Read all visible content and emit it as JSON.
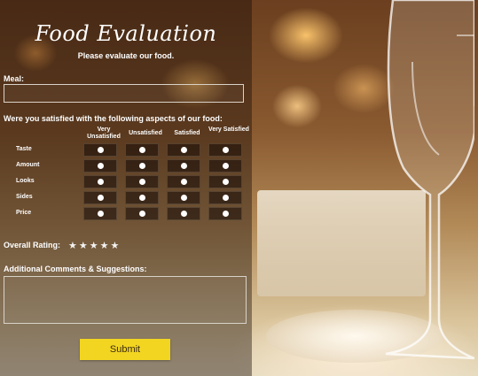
{
  "form": {
    "title": "Food Evaluation",
    "subtitle": "Please evaluate our food.",
    "meal_label": "Meal:",
    "meal_value": "",
    "satisfaction_label": "Were you satisfied with the following aspects of our food:",
    "columns": [
      "Very Unsatisfied",
      "Unsatisfied",
      "Satisfied",
      "Very Satisfied"
    ],
    "rows": [
      "Taste",
      "Amount",
      "Looks",
      "Sides",
      "Price"
    ],
    "overall_rating_label": "Overall Rating:",
    "overall_rating_stars": "★★★★★",
    "comments_label": "Additional Comments & Suggestions:",
    "comments_value": "",
    "submit_label": "Submit"
  },
  "colors": {
    "submit_bg": "#f2d521",
    "overlay": "rgba(25,12,6,0.42)"
  }
}
